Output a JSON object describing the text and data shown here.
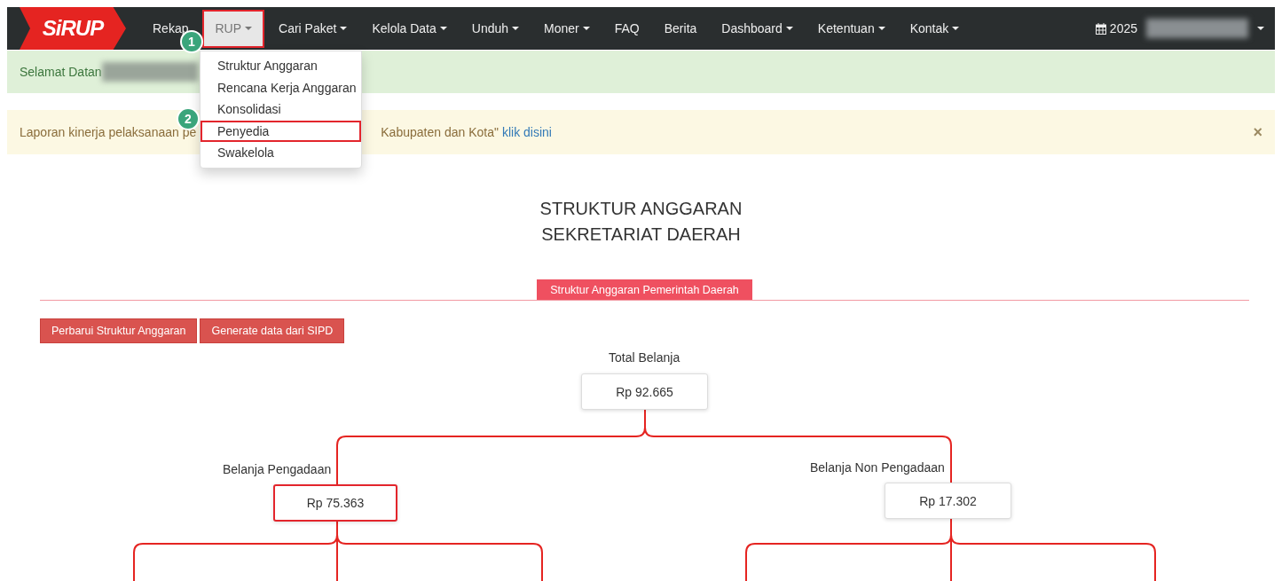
{
  "navbar": {
    "logo": "SiRUP",
    "items": [
      {
        "label": "Rekap",
        "dropdown": false,
        "selected": false,
        "highlighted": false
      },
      {
        "label": "RUP",
        "dropdown": true,
        "selected": true,
        "highlighted": true,
        "step": "1"
      },
      {
        "label": "Cari Paket",
        "dropdown": true,
        "selected": false,
        "highlighted": false
      },
      {
        "label": "Kelola Data",
        "dropdown": true,
        "selected": false,
        "highlighted": false
      },
      {
        "label": "Unduh",
        "dropdown": true,
        "selected": false,
        "highlighted": false
      },
      {
        "label": "Moner",
        "dropdown": true,
        "selected": false,
        "highlighted": false
      },
      {
        "label": "FAQ",
        "dropdown": false,
        "selected": false,
        "highlighted": false
      },
      {
        "label": "Berita",
        "dropdown": false,
        "selected": false,
        "highlighted": false
      },
      {
        "label": "Dashboard",
        "dropdown": true,
        "selected": false,
        "highlighted": false
      },
      {
        "label": "Ketentuan",
        "dropdown": true,
        "selected": false,
        "highlighted": false
      },
      {
        "label": "Kontak",
        "dropdown": true,
        "selected": false,
        "highlighted": false
      }
    ],
    "year": "2025"
  },
  "dropdown": {
    "items": [
      {
        "label": "Struktur Anggaran",
        "highlighted": false
      },
      {
        "label": "Rencana Kerja Anggaran",
        "highlighted": false
      },
      {
        "label": "Konsolidasi",
        "highlighted": false
      },
      {
        "label": "Penyedia",
        "highlighted": true,
        "step": "2"
      },
      {
        "label": "Swakelola",
        "highlighted": false
      }
    ]
  },
  "welcome_alert": {
    "text": "Selamat Datan"
  },
  "notice_alert": {
    "text_before": "Laporan kinerja pelaksanaan pe",
    "text_after": "Kabupaten dan Kota\"",
    "link": "klik disini",
    "close": "×"
  },
  "title": [
    "STRUKTUR ANGGARAN",
    "SEKRETARIAT DAERAH"
  ],
  "tab": {
    "label": "Struktur Anggaran Pemerintah Daerah",
    "selected": true
  },
  "buttons": [
    "Perbarui Struktur Anggaran",
    "Generate data dari SIPD"
  ],
  "tree": {
    "root": {
      "label": "Total Belanja",
      "value": "Rp 92.665",
      "highlighted": false
    },
    "children": [
      {
        "label": "Belanja Pengadaan",
        "value": "Rp 75.363",
        "highlighted": true
      },
      {
        "label": "Belanja Non Pengadaan",
        "value": "Rp 17.302",
        "highlighted": false
      }
    ]
  }
}
